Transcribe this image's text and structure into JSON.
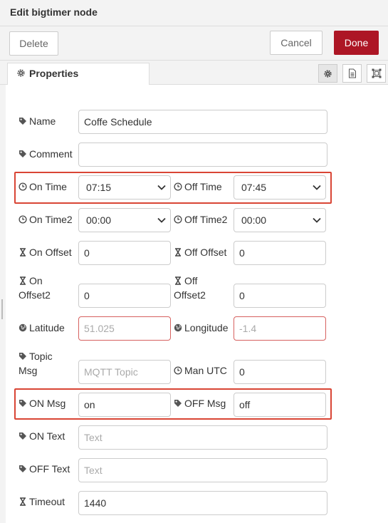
{
  "dialog": {
    "title": "Edit bigtimer node"
  },
  "toolbar": {
    "delete_label": "Delete",
    "cancel_label": "Cancel",
    "done_label": "Done"
  },
  "tabs": {
    "properties_label": "Properties"
  },
  "side_icons": [
    "gear-icon",
    "document-icon",
    "layout-icon"
  ],
  "form": {
    "name": {
      "label": "Name",
      "value": "Coffe Schedule"
    },
    "comment": {
      "label": "Comment",
      "value": ""
    },
    "on_time": {
      "label": "On Time",
      "value": "07:15"
    },
    "off_time": {
      "label": "Off Time",
      "value": "07:45"
    },
    "on_time2": {
      "label": "On Time2",
      "value": "00:00"
    },
    "off_time2": {
      "label": "Off Time2",
      "value": "00:00"
    },
    "on_offset": {
      "label": "On Offset",
      "value": "0"
    },
    "off_offset": {
      "label": "Off Offset",
      "value": "0"
    },
    "on_offset2": {
      "label_line1": "On",
      "label_line2": "Offset2",
      "value": "0"
    },
    "off_offset2": {
      "label_line1": "Off",
      "label_line2": "Offset2",
      "value": "0"
    },
    "latitude": {
      "label": "Latitude",
      "placeholder": "51.025"
    },
    "longitude": {
      "label": "Longitude",
      "placeholder": "-1.4"
    },
    "topic_msg": {
      "label_line1": "Topic",
      "label_line2": "Msg",
      "placeholder": "MQTT Topic"
    },
    "man_utc": {
      "label": "Man UTC",
      "value": "0"
    },
    "on_msg": {
      "label": "ON Msg",
      "value": "on"
    },
    "off_msg": {
      "label": "OFF Msg",
      "value": "off"
    },
    "on_text": {
      "label": "ON Text",
      "placeholder": "Text"
    },
    "off_text": {
      "label": "OFF Text",
      "placeholder": "Text"
    },
    "timeout": {
      "label": "Timeout",
      "value": "1440"
    }
  },
  "colors": {
    "done_button": "#ad1625",
    "highlight": "#d94535",
    "error_border": "#d6615f"
  }
}
